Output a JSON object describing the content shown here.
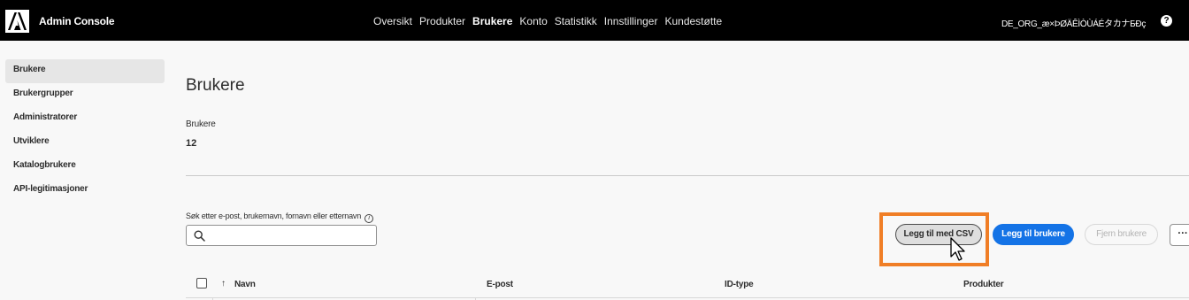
{
  "header": {
    "app_title": "Admin Console",
    "nav": [
      "Oversikt",
      "Produkter",
      "Brukere",
      "Konto",
      "Statistikk",
      "Innstillinger",
      "Kundestøtte"
    ],
    "active_nav": "Brukere",
    "org_name": "DE_ORG_æ×ÞØÄÊÌÒÙÁÉタカナБÐç",
    "help_symbol": "?"
  },
  "sidebar": {
    "items": [
      {
        "label": "Brukere",
        "active": true
      },
      {
        "label": "Brukergrupper",
        "active": false
      },
      {
        "label": "Administratorer",
        "active": false
      },
      {
        "label": "Utviklere",
        "active": false
      },
      {
        "label": "Katalogbrukere",
        "active": false
      },
      {
        "label": "API-legitimasjoner",
        "active": false
      }
    ]
  },
  "main": {
    "title": "Brukere",
    "count_label": "Brukere",
    "count_value": "12",
    "search": {
      "label": "Søk etter e-post, brukernavn, fornavn eller etternavn",
      "value": "",
      "placeholder": ""
    },
    "buttons": {
      "add_csv": "Legg til med CSV",
      "add_users": "Legg til brukere",
      "remove_users": "Fjern brukere",
      "more": "···"
    },
    "table": {
      "columns": [
        "Navn",
        "E-post",
        "ID-type",
        "Produkter"
      ]
    }
  },
  "colors": {
    "accent": "#1473e6",
    "highlight": "#f07e26",
    "topbar": "#000000"
  }
}
